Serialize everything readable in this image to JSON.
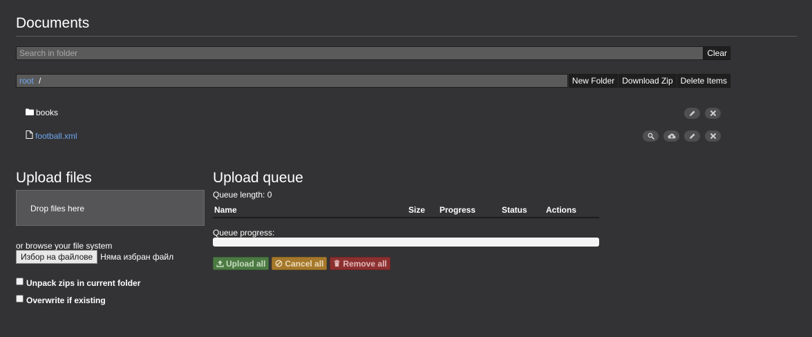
{
  "header": {
    "title": "Documents"
  },
  "search": {
    "placeholder": "Search in folder",
    "value": "",
    "clear_label": "Clear"
  },
  "path": {
    "root_label": "root",
    "separator": "/",
    "new_folder_label": "New Folder",
    "download_zip_label": "Download Zip",
    "delete_items_label": "Delete Items"
  },
  "files": [
    {
      "name": "books",
      "type": "folder",
      "icon": "folder-icon",
      "actions": [
        "edit-icon",
        "delete-icon"
      ]
    },
    {
      "name": "football.xml",
      "type": "file",
      "icon": "file-icon",
      "actions": [
        "preview-icon",
        "download-icon",
        "edit-icon",
        "delete-icon"
      ]
    }
  ],
  "upload": {
    "title": "Upload files",
    "drop_text": "Drop files here",
    "browse_text": "or browse your file system",
    "file_button_label": "Избор на файлове",
    "no_file_text": "Няма избран файл",
    "unpack_label": "Unpack zips in current folder",
    "overwrite_label": "Overwrite if existing",
    "unpack_checked": false,
    "overwrite_checked": false
  },
  "queue": {
    "title": "Upload queue",
    "length_text": "Queue length: 0",
    "columns": [
      "Name",
      "Size",
      "Progress",
      "Status",
      "Actions"
    ],
    "progress_label": "Queue progress:",
    "progress_value": 0,
    "upload_all_label": "Upload all",
    "cancel_all_label": "Cancel all",
    "remove_all_label": "Remove all"
  },
  "colors": {
    "background": "#333335",
    "link": "#6fa6ee",
    "success": "#4c7a43",
    "warning": "#a5782b",
    "danger": "#8c3030"
  }
}
